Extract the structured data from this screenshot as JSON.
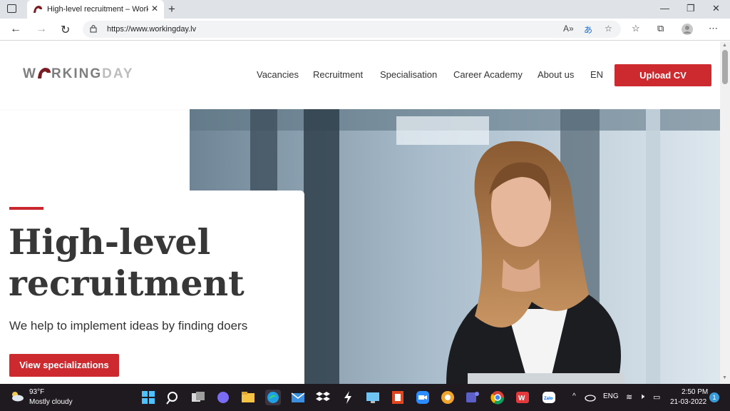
{
  "browser": {
    "tab_title": "High-level recruitment – Workin",
    "url": "https://www.workingday.lv"
  },
  "site": {
    "logo_text_a": "W",
    "logo_text_b": "RKING",
    "logo_text_c": "DAY",
    "nav": [
      {
        "label": "Vacancies"
      },
      {
        "label": "Recruitment"
      },
      {
        "label": "Specialisation"
      },
      {
        "label": "Career Academy"
      },
      {
        "label": "About us"
      },
      {
        "label": "EN"
      }
    ],
    "upload_label": "Upload CV"
  },
  "hero": {
    "title_line1": "High-level",
    "title_line2": "recruitment",
    "subtitle": "We help to implement ideas by finding doers",
    "cta_label": "View specializations"
  },
  "taskbar": {
    "weather_temp": "93°F",
    "weather_desc": "Mostly cloudy",
    "language": "ENG",
    "time": "2:50 PM",
    "date": "21-03-2022",
    "notification_count": "1"
  },
  "colors": {
    "accent": "#cd2a30",
    "taskbar_bg": "#1f1a20"
  }
}
